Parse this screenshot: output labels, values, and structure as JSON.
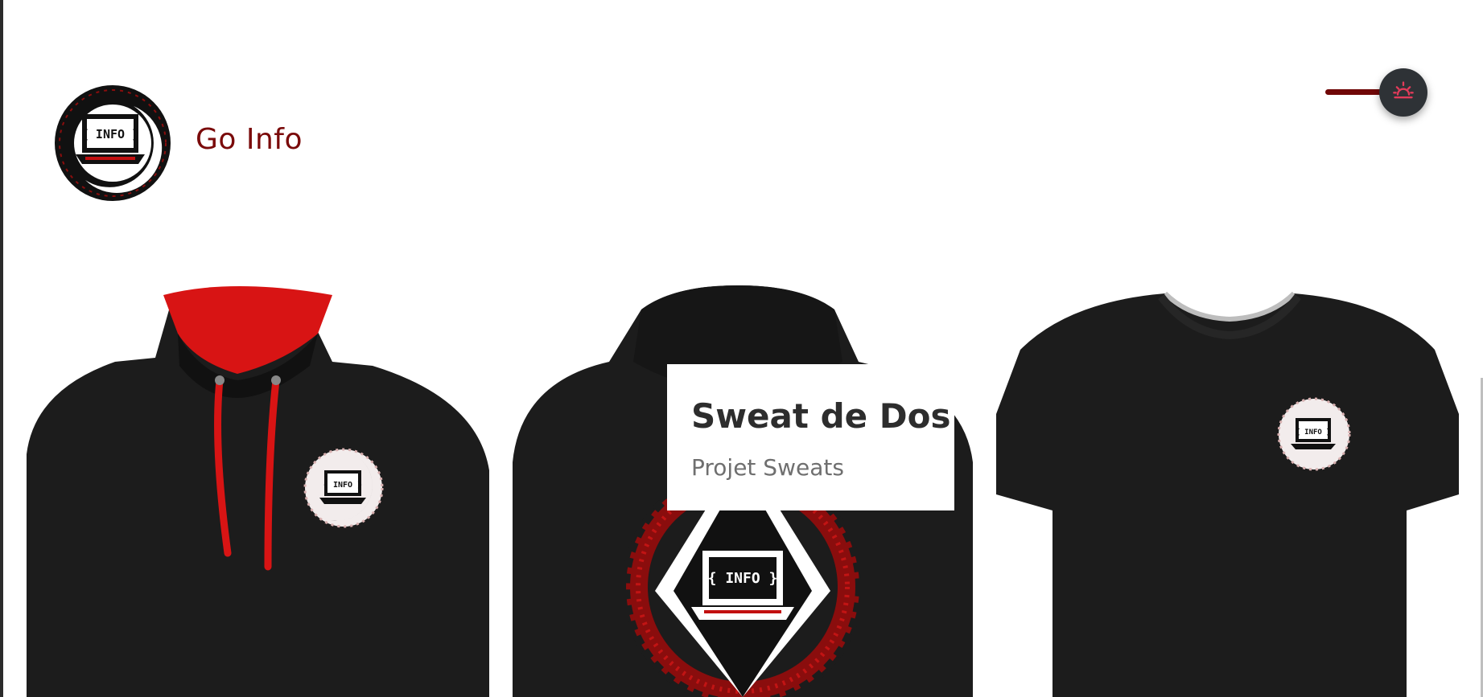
{
  "site": {
    "title": "Go Info",
    "logo_text": "{ INFO }"
  },
  "theme_toggle": {
    "icon": "sunrise-icon",
    "accent": "#700707",
    "icon_color": "#e23b5a"
  },
  "products": [
    {
      "type": "hoodie",
      "icon": "hoodie-front-image",
      "logo_text": "{ INFO }"
    },
    {
      "type": "hoodie-back",
      "icon": "hoodie-back-image",
      "logo_text": "{ INFO }",
      "caption": {
        "title": "Sweat de Dos",
        "subtitle": "Projet Sweats"
      }
    },
    {
      "type": "tshirt",
      "icon": "tshirt-image",
      "logo_text": "{ INFO }"
    }
  ],
  "colors": {
    "brand_dark_red": "#7a0a0a",
    "garment": "#1c1c1c",
    "hood_red": "#d81414"
  }
}
